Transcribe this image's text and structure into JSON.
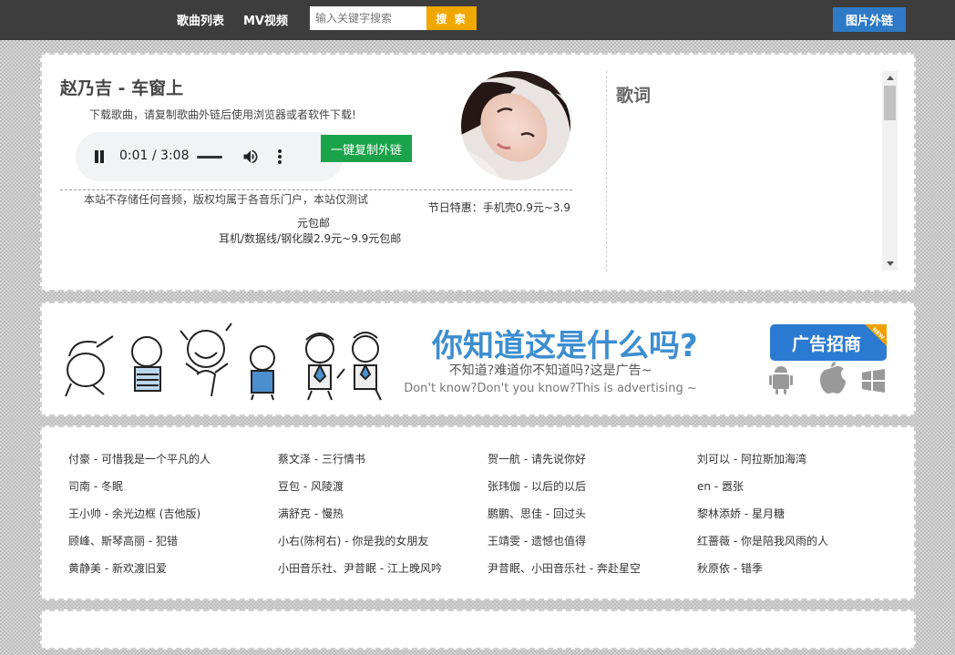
{
  "header": {
    "nav": [
      {
        "label": "歌曲列表"
      },
      {
        "label": "MV视频"
      }
    ],
    "search": {
      "placeholder": "输入关键字搜索",
      "button_label": "搜 索"
    },
    "external_link_button": "图片外链"
  },
  "player": {
    "song_title": "赵乃吉 - 车窗上",
    "download_notice": "下载歌曲，请复制歌曲外链后使用浏览器或者软件下载!",
    "time_display": "0:01 / 3:08",
    "progress": 0.005,
    "copy_link_button": "一键复制外链",
    "disclaimer": "本站不存储任何音频，版权均属于各音乐门户，本站仅测试",
    "promo_line1": "节日特惠：手机壳0.9元~3.9",
    "promo_line2": "元包邮",
    "promo_line3": "耳机/数据线/钢化膜2.9元~9.9元包邮",
    "lyrics_title": "歌词"
  },
  "ad": {
    "headline": "你知道这是什么吗?",
    "subline1": "不知道?难道你不知道吗?这是广告~",
    "subline2": "Don't know?Don't you know?This is advertising ~",
    "badge": "广告招商",
    "badge_corner": "NEW"
  },
  "songs": [
    "付豪 - 可惜我是一个平凡的人",
    "蔡文泽 - 三行情书",
    "贺一航 - 请先说你好",
    "刘可以 - 阿拉斯加海湾",
    "司南 - 冬眠",
    "豆包 - 风陵渡",
    "张玮伽 - 以后的以后",
    "en - 嚣张",
    "王小帅 - 余光边框 (吉他版)",
    "满舒克 - 慢热",
    "鹏鹏、思佳 - 回过头",
    "黎林添娇 - 星月糖",
    "顾峰、斯琴高丽 - 犯错",
    "小右(陈柯右) - 你是我的女朋友",
    "王靖雯 - 遗憾也值得",
    "红蔷薇 - 你是陪我风雨的人",
    "黄静美 - 新欢渡旧爱",
    "小田音乐社、尹昔眠 - 江上晚风吟",
    "尹昔眠、小田音乐社 - 奔赴星空",
    "秋原依 - 错季"
  ],
  "colors": {
    "topbar": "#3d3d3d",
    "search_button": "#f0a800",
    "external_button": "#2f7ac6",
    "copy_button": "#1aa34a",
    "ad_headline": "#3d8ed0",
    "ad_badge": "#2a7ad1"
  }
}
